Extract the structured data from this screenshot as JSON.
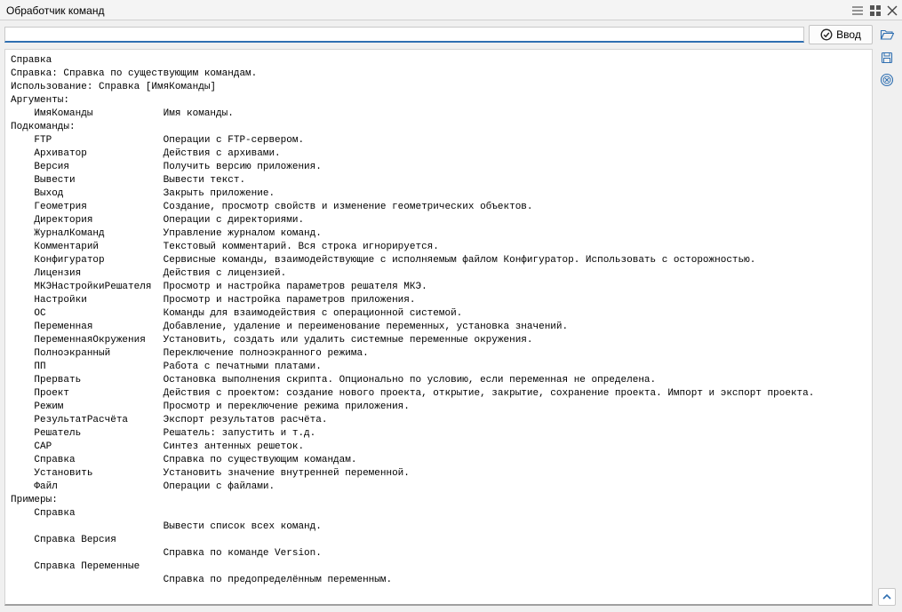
{
  "window": {
    "title": "Обработчик команд",
    "controls": [
      "menu-icon",
      "tile-icon",
      "close-icon"
    ]
  },
  "command_bar": {
    "input_value": "",
    "enter_label": "Ввод",
    "enter_icon": "check-circle-icon"
  },
  "side_toolbar": [
    "open-folder-icon",
    "save-icon",
    "clear-icon",
    "scroll-up-icon"
  ],
  "accent_color": "#2f6fb1",
  "output": {
    "lines": [
      "Справка",
      "Справка: Справка по существующим командам.",
      "Использование: Справка [ИмяКоманды]",
      "Аргументы:",
      "    ИмяКоманды            Имя команды.",
      "Подкоманды:",
      "    FTP                   Операции с FTP-сервером.",
      "    Архиватор             Действия с архивами.",
      "    Версия                Получить версию приложения.",
      "    Вывести               Вывести текст.",
      "    Выход                 Закрыть приложение.",
      "    Геометрия             Создание, просмотр свойств и изменение геометрических объектов.",
      "    Директория            Операции с директориями.",
      "    ЖурналКоманд          Управление журналом команд.",
      "    Комментарий           Текстовый комментарий. Вся строка игнорируется.",
      "    Конфигуратор          Сервисные команды, взаимодействующие с исполняемым файлом Конфигуратор. Использовать с осторожностью.",
      "    Лицензия              Действия с лицензией.",
      "    МКЭНастройкиРешателя  Просмотр и настройка параметров решателя МКЭ.",
      "    Настройки             Просмотр и настройка параметров приложения.",
      "    ОС                    Команды для взаимодействия с операционной системой.",
      "    Переменная            Добавление, удаление и переименование переменных, установка значений.",
      "    ПеременнаяОкружения   Установить, создать или удалить системные переменные окружения.",
      "    Полноэкранный         Переключение полноэкранного режима.",
      "    ПП                    Работа с печатными платами.",
      "    Прервать              Остановка выполнения скрипта. Опционально по условию, если переменная не определена.",
      "    Проект                Действия с проектом: создание нового проекта, открытие, закрытие, сохранение проекта. Импорт и экспорт проекта.",
      "    Режим                 Просмотр и переключение режима приложения.",
      "    РезультатРасчёта      Экспорт результатов расчёта.",
      "    Решатель              Решатель: запустить и т.д.",
      "    САР                   Синтез антенных решеток.",
      "    Справка               Справка по существующим командам.",
      "    Установить            Установить значение внутренней переменной.",
      "    Файл                  Операции с файлами.",
      "Примеры:",
      "    Справка",
      "                          Вывести список всех команд.",
      "    Справка Версия",
      "                          Справка по команде Version.",
      "    Справка Переменные",
      "                          Справка по предопределённым переменным."
    ]
  }
}
